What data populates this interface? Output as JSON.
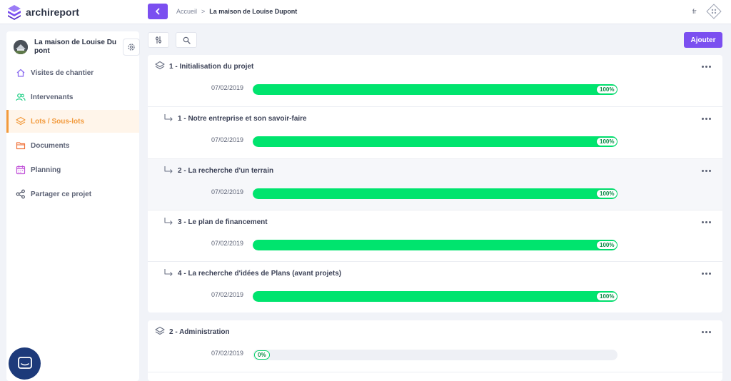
{
  "app": {
    "name": "archireport",
    "brand_color": "#7b4ff0"
  },
  "header": {
    "breadcrumb": [
      {
        "label": "Accueil"
      },
      {
        "label": "La maison de Louise Dupont"
      }
    ],
    "separator": ">",
    "language": "fr"
  },
  "sidebar": {
    "project_name": "La maison de Louise Du pont",
    "items": [
      {
        "label": "Visites de chantier",
        "icon": "home-icon",
        "color": "#8b6cf0"
      },
      {
        "label": "Intervenants",
        "icon": "users-icon",
        "color": "#1fcf85"
      },
      {
        "label": "Lots / Sous-lots",
        "icon": "layers-icon",
        "color": "#f29a3c",
        "active": true
      },
      {
        "label": "Documents",
        "icon": "folder-icon",
        "color": "#f0743c"
      },
      {
        "label": "Planning",
        "icon": "calendar-icon",
        "color": "#c04fd8"
      },
      {
        "label": "Partager ce projet",
        "icon": "share-icon",
        "color": "#3c4257"
      }
    ]
  },
  "toolbar": {
    "add_label": "Ajouter"
  },
  "lots": [
    {
      "title": "1 - Initialisation du projet",
      "date": "07/02/2019",
      "progress": 100,
      "progress_label": "100%",
      "subs": [
        {
          "title": "1 - Notre entreprise et son savoir-faire",
          "date": "07/02/2019",
          "progress": 100,
          "progress_label": "100%"
        },
        {
          "title": "2 - La recherche d'un terrain",
          "date": "07/02/2019",
          "progress": 100,
          "progress_label": "100%"
        },
        {
          "title": "3 - Le plan de financement",
          "date": "07/02/2019",
          "progress": 100,
          "progress_label": "100%"
        },
        {
          "title": "4 - La recherche d'idées de Plans (avant projets)",
          "date": "07/02/2019",
          "progress": 100,
          "progress_label": "100%"
        }
      ]
    },
    {
      "title": "2 - Administration",
      "date": "07/02/2019",
      "progress": 0,
      "progress_label": "0%",
      "subs": []
    }
  ],
  "colors": {
    "progress": "#00e46e",
    "accent": "#f29a3c"
  }
}
